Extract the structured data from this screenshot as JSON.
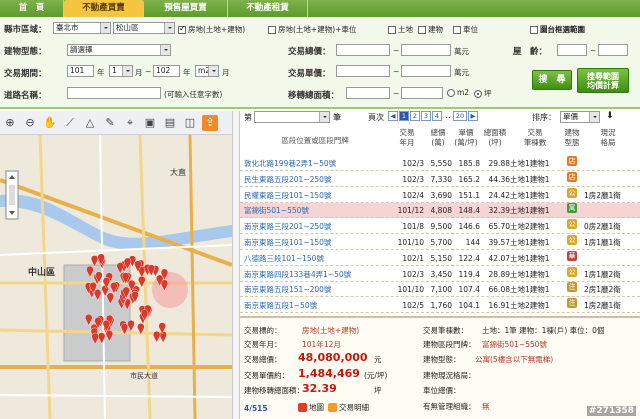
{
  "tabs": [
    "首　頁",
    "不動產買賣",
    "預售屋買賣",
    "不動產租賃"
  ],
  "form": {
    "district_label": "縣市區域：",
    "city": "臺北市",
    "area": "松山區",
    "type_opts": [
      "房地(土地+建物)",
      "房地(土地+建物)+車位",
      "土地",
      "建物",
      "車位"
    ],
    "bbox_label": "圖台框選範圍",
    "btype_label": "建物型態：",
    "btype": "請選擇",
    "total_label": "交易總價：",
    "unit_wan": "萬元",
    "age_label": "屋　齡：",
    "period_label": "交易期間：",
    "y1": "101",
    "m1": "1",
    "y2": "102",
    "m2": "m2",
    "year": "年",
    "month": "月",
    "unitprice_label": "交易單價：",
    "unit_wan2": "萬元",
    "road_label": "道路名稱：",
    "road_hint": "(可輸入任意字數)",
    "area_label": "移轉總面積：",
    "ping": "坪",
    "search_btn": "搜　尋",
    "calc_btn": "搜尋範圍\n均價計算"
  },
  "list": {
    "pre": "第",
    "post": "筆",
    "page_label": "頁次",
    "pages": [
      "1",
      "2",
      "3",
      "4"
    ],
    "dots": "..",
    "last": "20",
    "sort_label": "排序：",
    "sort": "單價"
  },
  "headers": [
    "區段位置或區段門牌",
    "交易\n年月",
    "總價\n(萬)",
    "單價\n(萬/坪)",
    "總面積\n(坪)",
    "交易\n筆棟數",
    "建物\n型態",
    "現況\n格局"
  ],
  "rows": [
    {
      "addr": "敦化北路199巷2弄1~50號",
      "ym": "102/3",
      "total": "5,550",
      "unit": "185.8",
      "area": "29.88",
      "parts": "土地1建物1",
      "type": "店",
      "layout": ""
    },
    {
      "addr": "民生東路五段201~250號",
      "ym": "102/3",
      "total": "7,330",
      "unit": "165.2",
      "area": "44.36",
      "parts": "土地1建物1",
      "type": "店",
      "layout": ""
    },
    {
      "addr": "民權東路三段101~150號",
      "ym": "102/4",
      "total": "3,690",
      "unit": "151.1",
      "area": "24.42",
      "parts": "土地1建物1",
      "type": "公",
      "layout": "1房2廳1衛"
    },
    {
      "addr": "富錦街501~550號",
      "ym": "101/12",
      "total": "4,808",
      "unit": "148.4",
      "area": "32.39",
      "parts": "土地1建物1",
      "type": "寓",
      "layout": ""
    },
    {
      "addr": "南京東路三段201~250號",
      "ym": "101/8",
      "total": "9,500",
      "unit": "146.6",
      "area": "65.70",
      "parts": "土地2建物1",
      "type": "公",
      "layout": "0房2廳1衛"
    },
    {
      "addr": "南京東路三段101~150號",
      "ym": "101/10",
      "total": "5,700",
      "unit": "144",
      "area": "39.57",
      "parts": "土地1建物1",
      "type": "公",
      "layout": "1房1廳1衛"
    },
    {
      "addr": "八德路三段101~150號",
      "ym": "102/1",
      "total": "5,150",
      "unit": "122.4",
      "area": "42.07",
      "parts": "土地1建物1",
      "type": "華",
      "layout": ""
    },
    {
      "addr": "南京東路四段133巷4弄1~50號",
      "ym": "102/3",
      "total": "3,450",
      "unit": "119.4",
      "area": "28.89",
      "parts": "土地1建物1",
      "type": "公",
      "layout": "1房1廳2衛"
    },
    {
      "addr": "南京東路五段151~200號",
      "ym": "101/10",
      "total": "7,100",
      "unit": "107.4",
      "area": "66.08",
      "parts": "土地1建物1",
      "type": "住",
      "layout": "2房1廳2衛"
    },
    {
      "addr": "南京東路五段1~50號",
      "ym": "102/5",
      "total": "1,760",
      "unit": "104.1",
      "area": "16.91",
      "parts": "土地2建物1",
      "type": "住",
      "layout": "1房2廳1衛"
    }
  ],
  "detail": {
    "l1": "交易標的：",
    "v1": "房地(土地+建物)",
    "l2": "交易年月：",
    "v2": "101年12月",
    "l3": "交易總價：",
    "v3": "48,080,000",
    "u3": "元",
    "l4": "交易單價約：",
    "v4": "1,484,469",
    "u4": "(元/坪)",
    "l5": "建物移轉總面積：",
    "v5": "32.39",
    "u5": "坪",
    "r1": "交易筆棟數：",
    "rv1": "土地：1筆 建物：1棟(戶) 車位：0個",
    "r2": "建物區段門牌：",
    "rv2": "富錦街501~550號",
    "r3": "建物型態：",
    "rv3": "公寓(5樓含以下無電梯)",
    "r4": "建物現況格局：",
    "rv4": "",
    "r5": "車位總價：",
    "rv5": "",
    "r6": "有無管理組織：",
    "rv6": "無",
    "count": "4/515",
    "map_btn": "地圖",
    "transfer_btn": "交易明細"
  },
  "map": {
    "label_zs": "中山區",
    "label_dz": "大直",
    "label_nd": "市民大道"
  },
  "watermark": "#271358",
  "accent": "#f4c53f",
  "green": "#5e9a2c"
}
